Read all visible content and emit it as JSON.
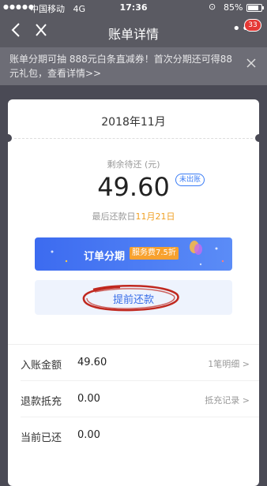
{
  "status_bar": {
    "signal": "●●●●●",
    "carrier": "中国移动",
    "network": "4G",
    "time": "17:36",
    "battery": "85%"
  },
  "nav": {
    "back_icon": "chevron-left",
    "close_icon": "close",
    "title": "账单详情",
    "more_icon": "more-dots",
    "badge_count": "33"
  },
  "notice": {
    "text": "账单分期可抽 888元白条直减券！首次分期还可得88元礼包，查看详情>>"
  },
  "bill": {
    "month": "2018年11月",
    "remain_label": "剩余待还 (元)",
    "amount": "49.60",
    "status": "未出账",
    "due_prefix": "最后还款日",
    "due_date": "11月21日"
  },
  "actions": {
    "installment_label": "订单分期",
    "installment_fee": "服务费7.5折",
    "prepay_label": "提前还款"
  },
  "details": [
    {
      "key": "入账金额",
      "value": "49.60",
      "link": "1笔明细 >"
    },
    {
      "key": "退款抵充",
      "value": "0.00",
      "link": "抵充记录 >"
    },
    {
      "key": "当前已还",
      "value": "0.00",
      "link": ""
    }
  ],
  "colors": {
    "accent": "#3a6fe8",
    "badge": "#e53935",
    "fee": "#f7a12f",
    "annotation": "#c0281f"
  }
}
